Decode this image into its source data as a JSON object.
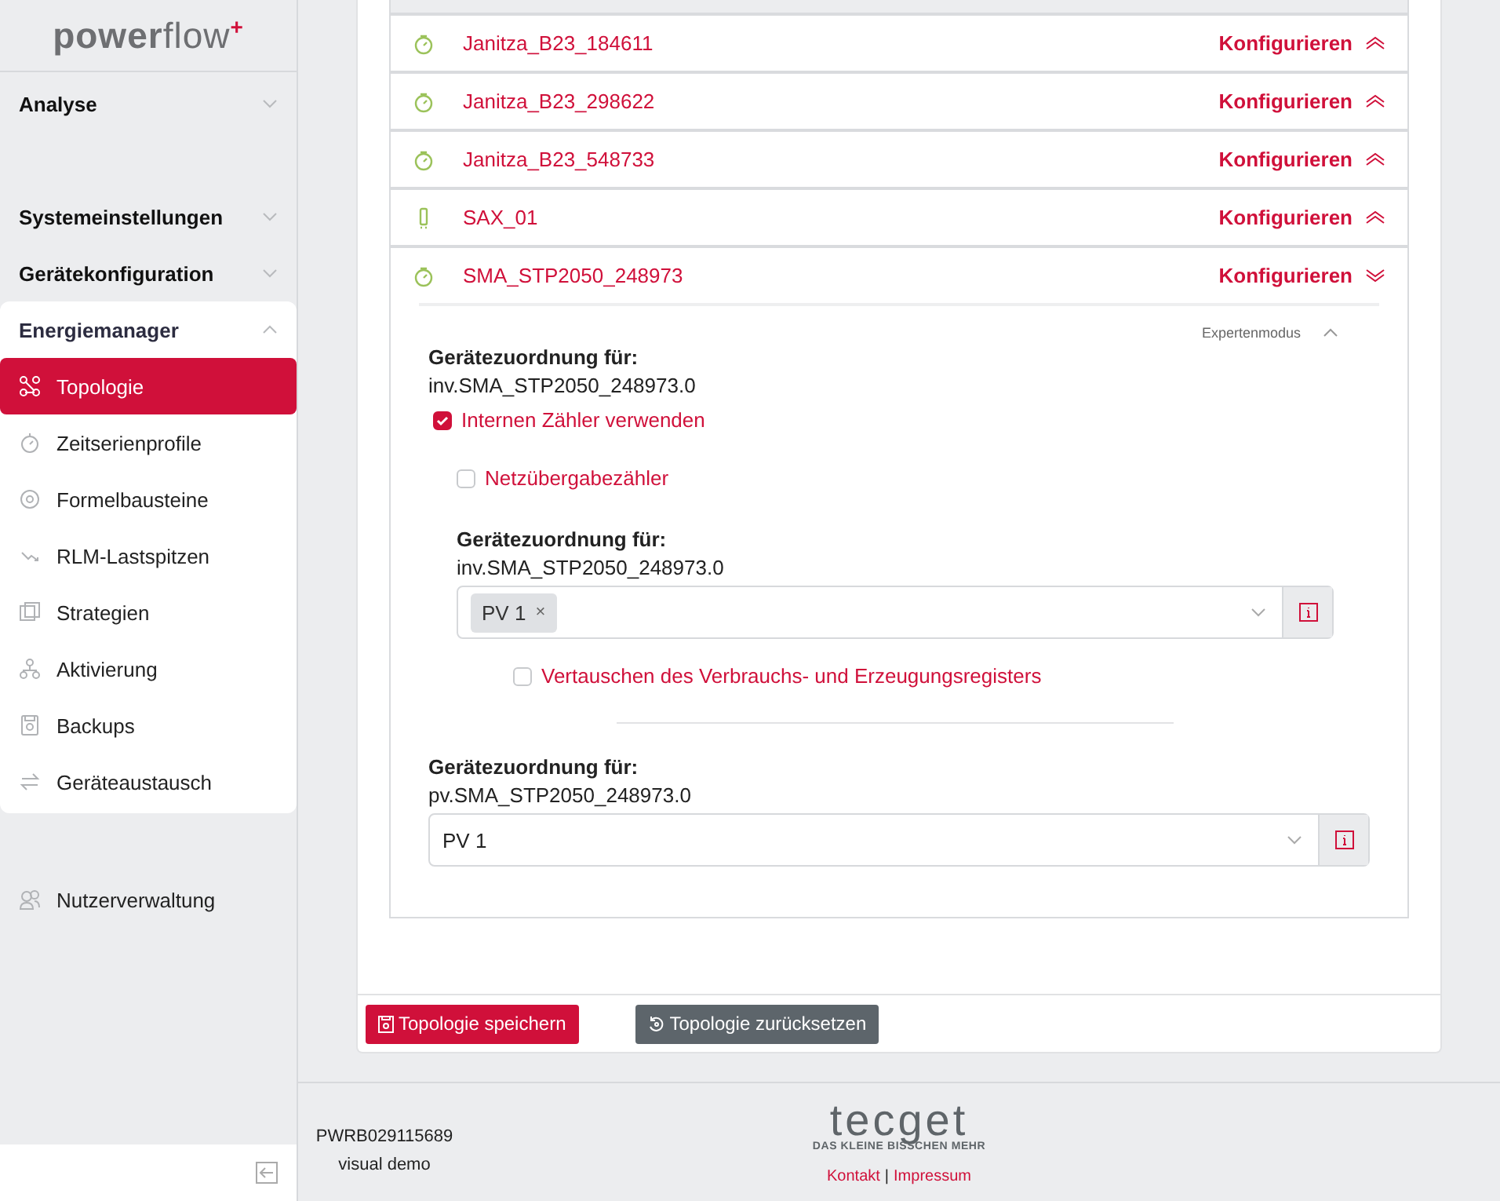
{
  "sidebar": {
    "logo": "**power**flow$^{+}$",
    "groups": [
      {
        "label": "Analyse",
        "expanded": false
      },
      {
        "label": "Systemeinstellungen",
        "expanded": false
      },
      {
        "label": "Gerätekonfiguration",
        "expanded": false
      },
      {
        "label": "Energiemanager",
        "expanded": true,
        "children": [
          {
            "label": "Topologie",
            "selected": true
          },
          {
            "label": "Zeitserienprofile",
            "selected": false
          },
          {
            "label": "Formelbausteine",
            "selected": false
          },
          {
            "label": "RLM-Lastspitzen",
            "selected": false
          },
          {
            "label": "Strategien",
            "selected": false
          },
          {
            "label": "Aktivierung",
            "selected": false
          },
          {
            "label": "Backups",
            "selected": false
          },
          {
            "label": "Geräteaustausch",
            "selected": false
          }
        ]
      }
    ],
    "bottom_items": [
      {
        "label": "Nutzerverwaltung",
        "selected": false
      }
    ]
  },
  "devices": [
    {
      "name": "Janitza_B23_184611",
      "kind": "meter",
      "action": "Konfigurieren",
      "expanded": false
    },
    {
      "name": "Janitza_B23_298622",
      "kind": "meter",
      "action": "Konfigurieren",
      "expanded": false
    },
    {
      "name": "Janitza_B23_548733",
      "kind": "meter",
      "action": "Konfigurieren",
      "expanded": false
    },
    {
      "name": "SAX_01",
      "kind": "battery",
      "action": "Konfigurieren",
      "expanded": false
    },
    {
      "name": "SMA_STP2050_248973",
      "kind": "meter",
      "action": "Konfigurieren",
      "expanded": true
    }
  ],
  "detail": {
    "expert_mode": "Expertenmodus",
    "assignment": {
      "label": "Gerätezuordnung für:",
      "target": "inv.SMA_STP2050_248973.0"
    },
    "use_internal": {
      "label": "Internen Zähler verwenden",
      "checked": true
    },
    "grid_meter": {
      "label": "Netzübergabezähler",
      "checked": false
    },
    "sub_assignment": {
      "label": "Gerätezuordnung für:",
      "target": "inv.SMA_STP2050_248973.0",
      "tags": [
        "PV 1"
      ],
      "tag_remove": "×"
    },
    "swap": {
      "label": "Vertauschen des Verbrauchs- und Erzeugungsregisters",
      "checked": false
    },
    "pv_assignment": {
      "label": "Gerätezuordnung für:",
      "target": "pv.SMA_STP2050_248973.0",
      "value": "PV 1"
    }
  },
  "buttons": [
    {
      "label": "Topologie speichern",
      "kind": "primary"
    },
    {
      "label": "Topologie zurücksetzen",
      "kind": "secondary"
    }
  ],
  "footer": {
    "serial": "PWRB029115689",
    "mode": "visual demo",
    "logo": "tecget",
    "tagline": "DAS KLEINE BISSCHEN MEHR",
    "links": [
      "Kontakt",
      "Impressum"
    ],
    "separator": "|"
  }
}
